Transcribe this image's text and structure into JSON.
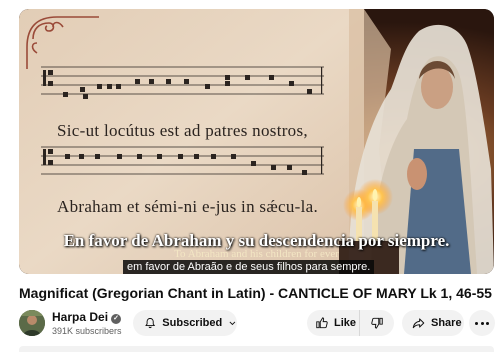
{
  "video": {
    "score_lyrics": {
      "line1": "Sic-ut locútus est ad patres nostros,",
      "line2": "Abraham et sémi-ni e-jus in sǽcu-la."
    },
    "subtitles": {
      "spanish": "En favor de Abraham y su descendencia por siempre.",
      "english": "To Abraham and his children for ever",
      "portuguese_caption": "em favor de Abraão e de seus filhos para sempre."
    }
  },
  "title": "Magnificat (Gregorian Chant in Latin) - CANTICLE OF MARY Lk 1, 46-55",
  "channel": {
    "name": "Harpa Dei",
    "verified_icon": "check-icon",
    "subscribers": "391K subscribers"
  },
  "actions": {
    "subscribe_label": "Subscribed",
    "like_label": "Like",
    "share_label": "Share"
  },
  "colors": {
    "parchment": "#e9d9c4",
    "pill_bg": "#f2f2f2"
  }
}
